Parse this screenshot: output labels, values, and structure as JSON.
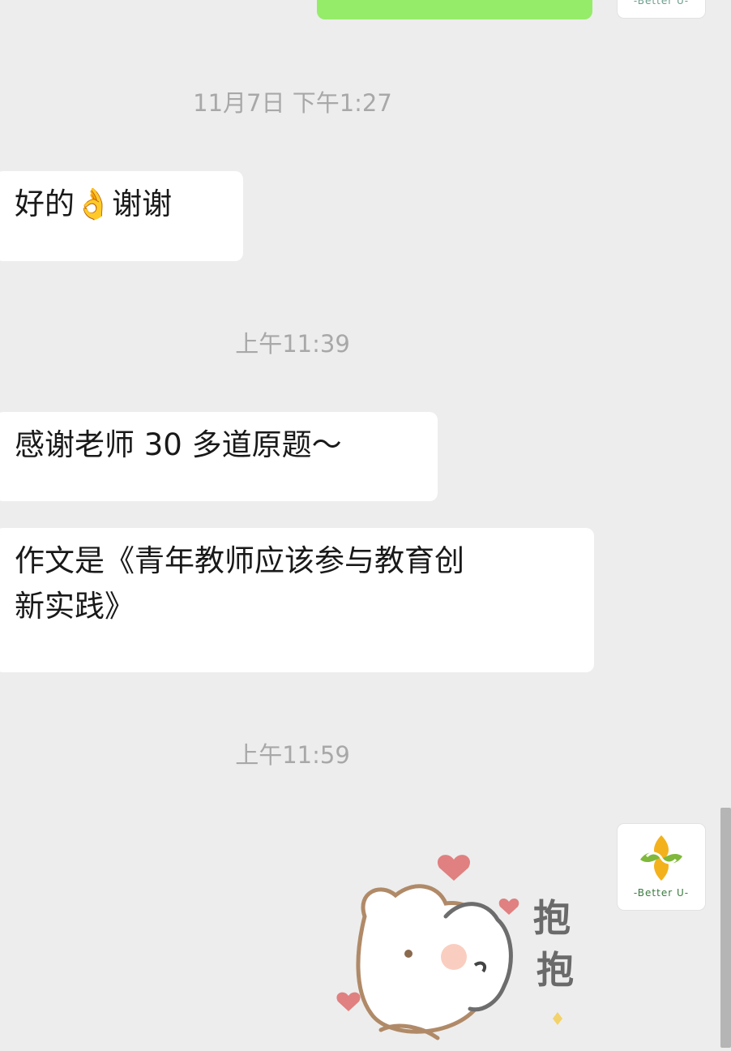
{
  "timestamps": {
    "t1": "11月7日 下午1:27",
    "t2": "上午11:39",
    "t3": "上午11:59"
  },
  "messages": {
    "m1_prefix": "好的",
    "m1_emoji": "👌",
    "m1_suffix": "谢谢",
    "m2": "感谢老师 30 多道原题～",
    "m3_line1": "作文是《青年教师应该参与教育创",
    "m3_line2": "新实践》"
  },
  "avatar": {
    "caption": "-Better U-",
    "logo_colors": [
      "#7fb83a",
      "#f3b21c"
    ]
  },
  "sticker": {
    "text1": "抱",
    "text2": "抱",
    "description_icon": "bear-hug-sticker"
  },
  "colors": {
    "background": "#ededed",
    "outgoing_bubble": "#95ec69",
    "incoming_bubble": "#ffffff",
    "timestamp_text": "#a8a8a8",
    "heart": "#e08080"
  }
}
